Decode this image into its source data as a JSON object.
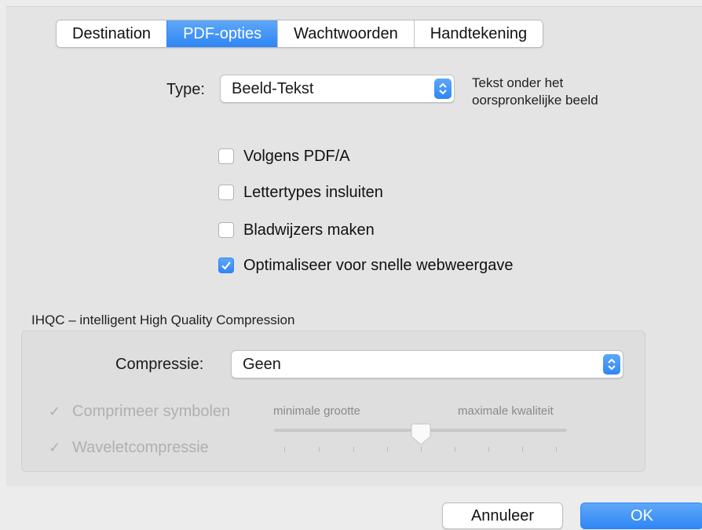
{
  "tabs": [
    {
      "label": "Destination",
      "active": false
    },
    {
      "label": "PDF-opties",
      "active": true
    },
    {
      "label": "Wachtwoorden",
      "active": false
    },
    {
      "label": "Handtekening",
      "active": false
    }
  ],
  "type_field": {
    "label": "Type:",
    "value": "Beeld-Tekst",
    "description_line1": "Tekst onder het",
    "description_line2": "oorspronkelijke beeld"
  },
  "options": [
    {
      "label": "Volgens PDF/A",
      "checked": false
    },
    {
      "label": "Lettertypes insluiten",
      "checked": false
    },
    {
      "label": "Bladwijzers maken",
      "checked": false
    },
    {
      "label": "Optimaliseer voor snelle webweergave",
      "checked": true
    }
  ],
  "compression": {
    "section_title": "IHQC – intelligent High Quality Compression",
    "label": "Compressie:",
    "value": "Geen",
    "symbols_label": "Comprimeer symbolen",
    "symbols_checked": true,
    "wavelet_label": "Waveletcompressie",
    "wavelet_checked": true,
    "slider_min_label": "minimale grootte",
    "slider_max_label": "maximale kwaliteit",
    "slider_value": 0.5,
    "enabled": false
  },
  "buttons": {
    "cancel": "Annuleer",
    "ok": "OK"
  },
  "colors": {
    "accent": "#2f86f5",
    "disabled_text": "#b0b0b0"
  }
}
